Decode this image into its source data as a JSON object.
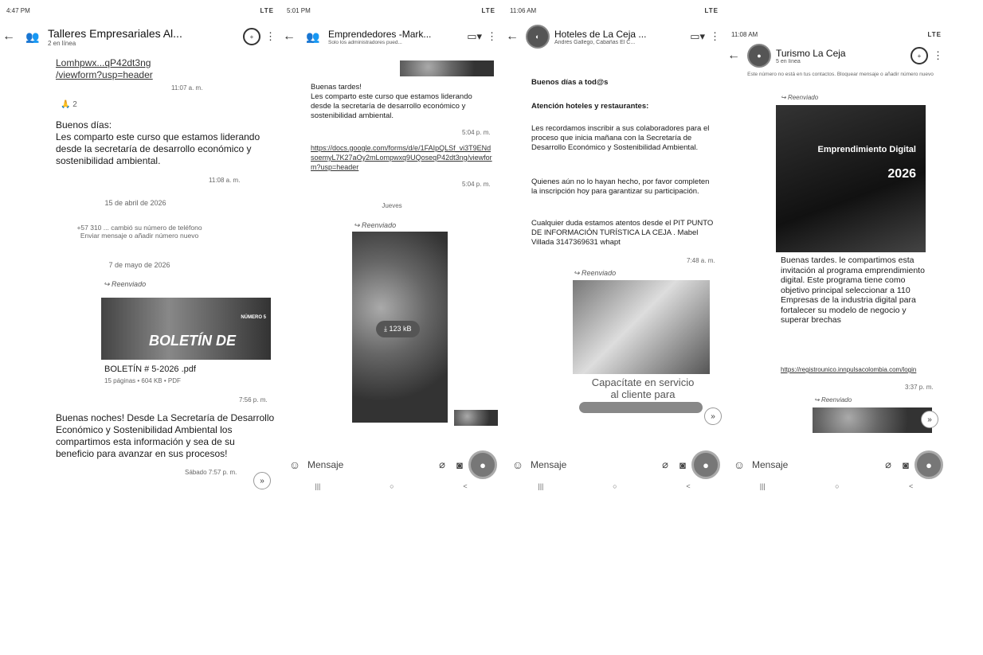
{
  "panels": [
    {
      "status_time": "4:47 PM",
      "status_right": "LTE",
      "title": "Talleres Empresariales Al...",
      "subtitle": "2 en línea",
      "link_lines": [
        "Lomhpwx...qP42dt3ng",
        "/viewform?usp=header"
      ],
      "link_time": "11:07 a. m.",
      "reaction": "🙏 2",
      "message": "Buenos días:\nLes comparto este curso que estamos liderando desde la secretaría de desarrollo económico y sostenibilidad ambiental.",
      "message_time": "11:08 a. m.",
      "date1": "15 de abril de 2026",
      "system_line1": "+57 310 ... cambió su número de teléfono",
      "system_line2": "Enviar mensaje o añadir número nuevo",
      "date2": "7 de mayo de 2026",
      "forwarded": "Reenviado",
      "doc_banner": "BOLETÍN DE",
      "doc_banner_tag": "NÚMERO 5",
      "doc_name": "BOLETÍN # 5-2026 .pdf",
      "doc_meta": "15 páginas • 604 KB • PDF",
      "doc_time": "7:56 p. m.",
      "message2": "Buenas noches! Desde La Secretaría de Desarrollo Económico y Sostenibilidad Ambiental los compartimos esta información y sea de su beneficio para avanzar en sus procesos!",
      "message2_time": "Sábado 7:57 p. m."
    },
    {
      "status_time": "5:01 PM",
      "status_right": "LTE",
      "title": "Emprendedores -Mark...",
      "subtitle": "Solo los administradores pued...",
      "message": "Buenas tardes!\nLes comparto este curso que estamos liderando desde la secretaría de desarrollo económico y sostenibilidad ambiental.",
      "message_time": "5:04 p. m.",
      "link_text": "https://docs.google.com/forms/d/e/1FAIpQLSf_vi3T9ENdsoemyL7K27aOy2mLompwxq9UQoseqP42dt3ng/viewform?usp=header",
      "link_time": "5:04 p. m.",
      "date": "Jueves",
      "forwarded": "Reenviado",
      "download_size": "123 kB",
      "input_placeholder": "Mensaje"
    },
    {
      "status_time": "11:06 AM",
      "status_right": "LTE",
      "title": "Hoteles de La Ceja ...",
      "subtitle": "Andrés Gallego, Cabañas El C...",
      "greeting": "Buenos días a tod@s",
      "headline": "Atención hoteles y restaurantes:",
      "para1": "Les recordamos inscribir a sus colaboradores para el proceso que inicia mañana con la Secretaría de Desarrollo Económico y Sostenibilidad Ambiental.",
      "para2": "Quienes aún no lo hayan hecho, por favor completen la inscripción hoy para garantizar su participación.",
      "para3": "Cualquier duda estamos atentos desde el PIT PUNTO DE INFORMACIÓN TURÍSTICA LA CEJA . Mabel Villada 3147369631 whapt",
      "para_time": "7:48 a. m.",
      "forwarded": "Reenviado",
      "promo_line1": "Capacítate en servicio",
      "promo_line2": "al cliente para",
      "input_placeholder": "Mensaje"
    },
    {
      "status_time": "11:08 AM",
      "status_right": "LTE",
      "title": "Turismo La Ceja",
      "subtitle": "5 en línea",
      "info_line": "Este número no está en tus contactos. Bloquear mensaje o añadir número nuevo",
      "forwarded": "Reenviado",
      "poster_title": "Emprendimiento Digital",
      "poster_year": "2026",
      "message": "Buenas tardes. le compartimos esta invitación al programa emprendimiento digital. Este programa tiene como objetivo principal seleccionar a 110 Empresas de la industria digital para fortalecer su modelo de negocio y superar brechas",
      "link_text": "https://registrounico.innpulsacolombia.com/login",
      "message_time": "3:37 p. m.",
      "forwarded2": "Reenviado",
      "input_placeholder": "Mensaje"
    }
  ],
  "input_placeholder": "Mensaje"
}
